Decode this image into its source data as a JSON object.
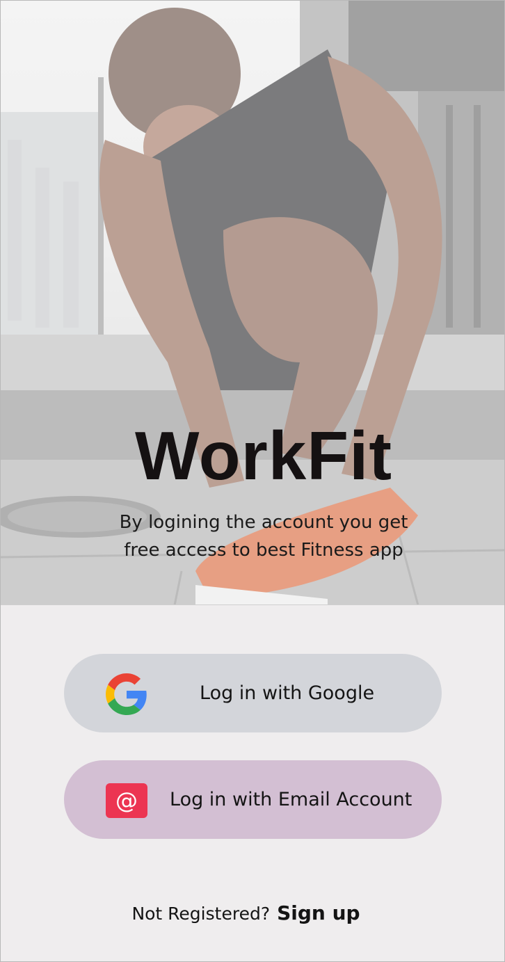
{
  "app": {
    "title": "WorkFit",
    "tagline": "By logining the account you get free access to best Fitness app"
  },
  "hero": {
    "image": "runner-tying-shoe-photo"
  },
  "auth": {
    "google": {
      "label": "Log in with Google",
      "icon": "google-icon"
    },
    "email": {
      "label": "Log in with Email Account",
      "icon": "at-sign-icon",
      "icon_glyph": "@"
    }
  },
  "footer": {
    "prompt": "Not Registered?",
    "signup_label": "Sign up"
  },
  "colors": {
    "background": "#efedee",
    "google_button": "#d3d5da",
    "email_button": "#d3bfd3",
    "email_icon": "#ec3552",
    "text": "#141414"
  }
}
